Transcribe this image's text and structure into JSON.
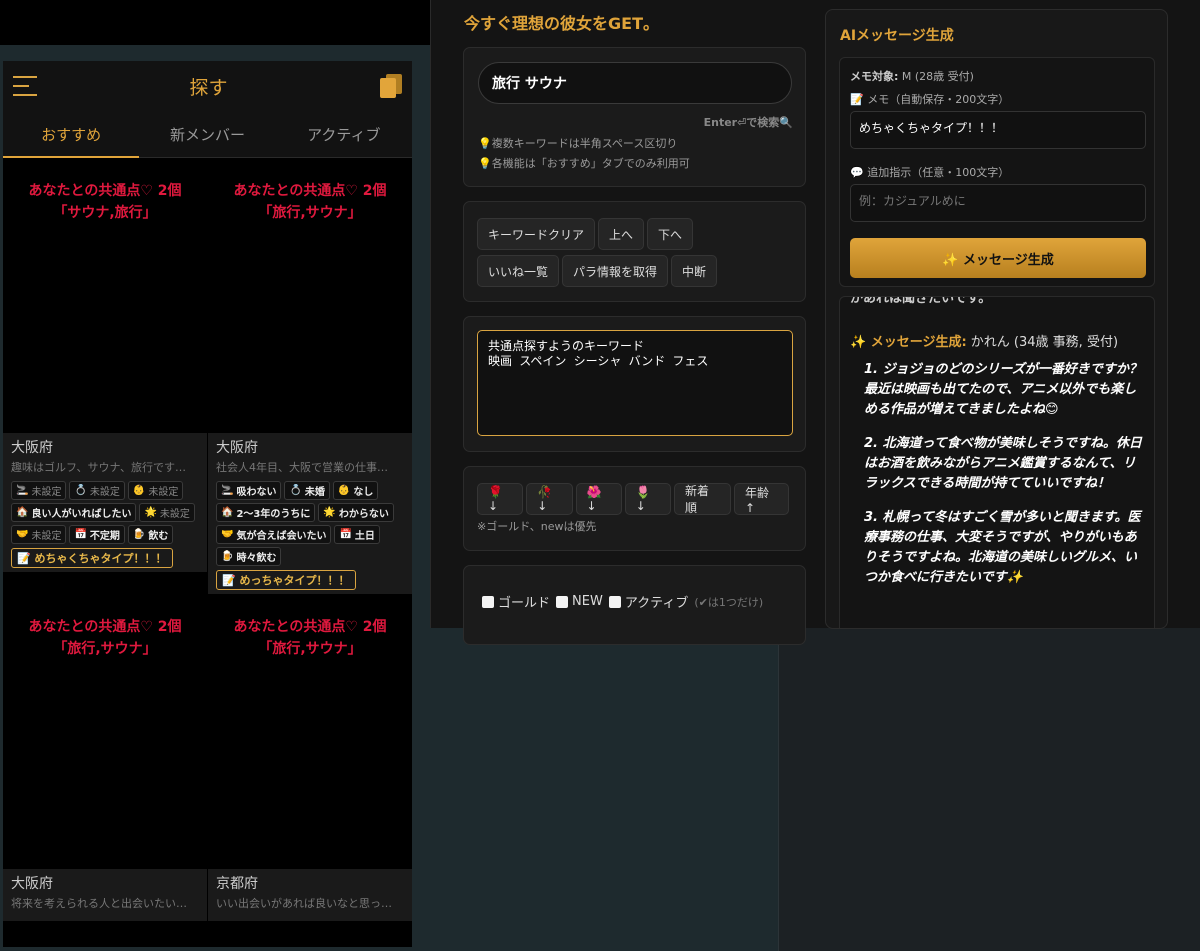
{
  "app": {
    "title": "探す",
    "tabs": [
      "おすすめ",
      "新メンバー",
      "アクティブ"
    ],
    "cards": [
      {
        "common_line1": "あなたとの共通点♡ 2個",
        "common_line2": "「サウナ,旅行」",
        "prefecture": "大阪府",
        "intro": "趣味はゴルフ、サウナ、旅行です…",
        "tags": [
          {
            "icon": "🚬",
            "label": "未設定",
            "dim": true
          },
          {
            "icon": "💍",
            "label": "未設定",
            "dim": true
          },
          {
            "icon": "👶",
            "label": "未設定",
            "dim": true
          },
          {
            "icon": "🏠",
            "label": "良い人がいればしたい",
            "dim": false
          },
          {
            "icon": "🌟",
            "label": "未設定",
            "dim": true
          },
          {
            "icon": "🤝",
            "label": "未設定",
            "dim": true
          },
          {
            "icon": "📅",
            "label": "不定期",
            "dim": false
          },
          {
            "icon": "🍺",
            "label": "飲む",
            "dim": false
          }
        ],
        "memo": "📝 めちゃくちゃタイプ！！！"
      },
      {
        "common_line1": "あなたとの共通点♡ 2個",
        "common_line2": "「旅行,サウナ」",
        "prefecture": "大阪府",
        "intro": "社会人4年目、大阪で営業の仕事…",
        "tags": [
          {
            "icon": "🚬",
            "label": "吸わない",
            "dim": false
          },
          {
            "icon": "💍",
            "label": "未婚",
            "dim": false
          },
          {
            "icon": "👶",
            "label": "なし",
            "dim": false
          },
          {
            "icon": "🏠",
            "label": "2〜3年のうちに",
            "dim": false
          },
          {
            "icon": "🌟",
            "label": "わからない",
            "dim": false
          },
          {
            "icon": "🤝",
            "label": "気が合えば会いたい",
            "dim": false
          },
          {
            "icon": "📅",
            "label": "土日",
            "dim": false
          },
          {
            "icon": "🍺",
            "label": "時々飲む",
            "dim": false
          }
        ],
        "memo": "📝 めっちゃタイプ！！！"
      },
      {
        "common_line1": "あなたとの共通点♡ 2個",
        "common_line2": "「旅行,サウナ」",
        "prefecture": "大阪府",
        "intro": "将来を考えられる人と出会いたい…",
        "tags": [],
        "memo": ""
      },
      {
        "common_line1": "あなたとの共通点♡ 2個",
        "common_line2": "「旅行,サウナ」",
        "prefecture": "京都府",
        "intro": "いい出会いがあれば良いなと思っ…",
        "tags": [],
        "memo": ""
      }
    ]
  },
  "panel": {
    "title": "今すぐ理想の彼女をGET。",
    "search_value": "旅行 サウナ",
    "enter_hint": "Enter⏎で検索🔍",
    "notes": [
      "💡複数キーワードは半角スペース区切り",
      "💡各機能は「おすすめ」タブでのみ利用可"
    ],
    "buttons_row1": [
      "キーワードクリア",
      "上へ",
      "下へ"
    ],
    "buttons_row2": [
      "いいね一覧",
      "パラ情報を取得",
      "中断"
    ],
    "keywords_text": "共通点探すようのキーワード\n映画 スペイン シーシャ バンド フェス",
    "sort_buttons": [
      "🌹↓",
      "🥀↓",
      "🌺↓",
      "🌷↓",
      "新着順",
      "年齢↑"
    ],
    "sort_note": "※ゴールド、newは優先",
    "checkboxes": [
      "ゴールド",
      "NEW",
      "アクティブ"
    ],
    "checkbox_note": "(✔は1つだけ)"
  },
  "ai": {
    "title": "AIメッセージ生成",
    "target_label": "メモ対象:",
    "target_value": "M (28歳 受付)",
    "memo_label": "📝 メモ（自動保存・200文字）",
    "memo_value": "めちゃくちゃタイプ！！！",
    "extra_label": "💬 追加指示（任意・100文字）",
    "extra_placeholder": "例：カジュアルめに",
    "generate_button": "✨ メッセージ生成",
    "output_cut_line": "かあれは聞きたいです。",
    "output_label": "✨ メッセージ生成:",
    "output_target": "かれん (34歳 事務, 受付)",
    "output_items": [
      "1. ジョジョのどのシリーズが一番好きですか？最近は映画も出てたので、アニメ以外でも楽しめる作品が増えてきましたよね😊",
      "2. 北海道って食べ物が美味しそうですね。休日はお酒を飲みながらアニメ鑑賞するなんて、リラックスできる時間が持てていいですね！",
      "3. 札幌って冬はすごく雪が多いと聞きます。医療事務の仕事、大変そうですが、やりがいもありそうですよね。北海道の美味しいグルメ、いつか食べに行きたいです✨"
    ]
  },
  "colors": {
    "accent": "#e0a43a",
    "common_red": "#e0193e"
  }
}
